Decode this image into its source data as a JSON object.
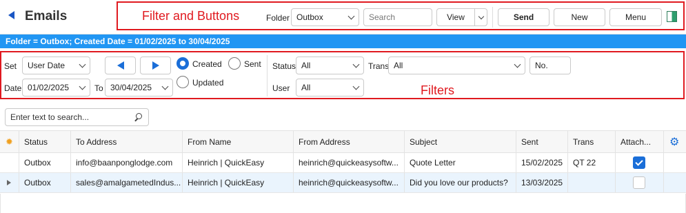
{
  "header": {
    "title": "Emails"
  },
  "annotations": {
    "filter_and_buttons": "Filter and Buttons",
    "filters": "Filters"
  },
  "toolbar": {
    "folder_label": "Folder",
    "folder_value": "Outbox",
    "search_placeholder": "Search",
    "view_label": "View",
    "send_label": "Send",
    "new_label": "New",
    "menu_label": "Menu"
  },
  "banner": {
    "text": "Folder = Outbox; Created Date = 01/02/2025 to 30/04/2025"
  },
  "filters": {
    "set_label": "Set",
    "set_value": "User Date",
    "date_label": "Date",
    "date_from": "01/02/2025",
    "to_label": "To",
    "date_to": "30/04/2025",
    "radio_created": "Created",
    "radio_sent": "Sent",
    "radio_updated": "Updated",
    "status_label": "Status",
    "status_value": "All",
    "trans_label": "Trans",
    "trans_value": "All",
    "number_placeholder": "No.",
    "user_label": "User",
    "user_value": "All"
  },
  "grid": {
    "search_placeholder": "Enter text to search...",
    "columns": [
      "Status",
      "To Address",
      "From Name",
      "From Address",
      "Subject",
      "Sent",
      "Trans",
      "Attach..."
    ],
    "rows": [
      {
        "status": "Outbox",
        "to": "info@baanponglodge.com",
        "from_name": "Heinrich | QuickEasy",
        "from_address": "heinrich@quickeasysoftw...",
        "subject": "Quote Letter",
        "sent": "15/02/2025",
        "trans": "QT 22",
        "attached": true
      },
      {
        "status": "Outbox",
        "to": "sales@amalgametedIndus...",
        "from_name": "Heinrich | QuickEasy",
        "from_address": "heinrich@quickeasysoftw...",
        "subject": "Did you love our products?",
        "sent": "13/03/2025",
        "trans": "",
        "attached": false
      }
    ]
  },
  "colors": {
    "accent": "#2196f3",
    "annotation": "#e0191f",
    "link_blue": "#1a6ed8"
  }
}
